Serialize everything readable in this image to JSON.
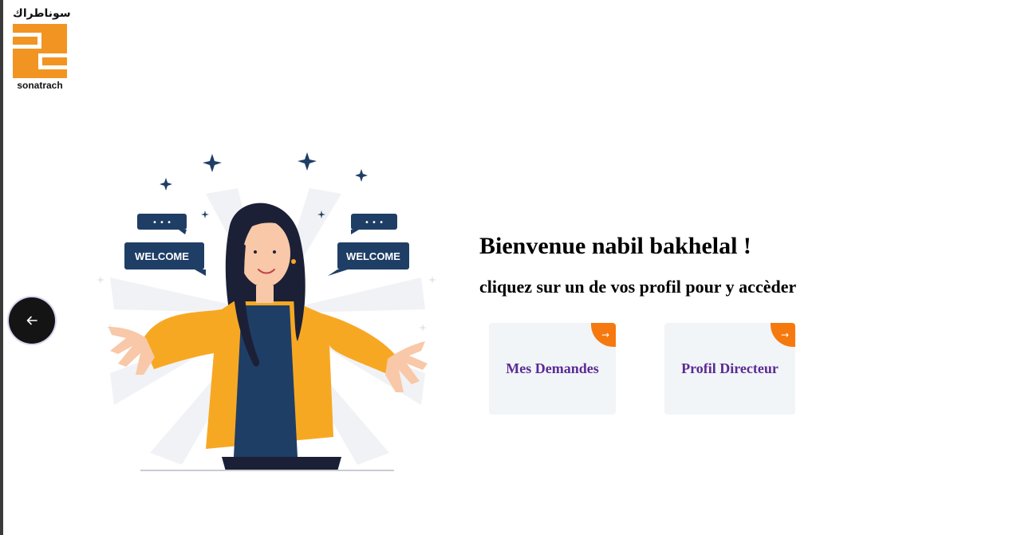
{
  "brand": {
    "arabic_name": "سوناطراك",
    "latin_name": "sonatrach",
    "color": "#f29422"
  },
  "back_button": {
    "icon": "arrow-left-icon"
  },
  "illustration": {
    "bubble_left_text": "WELCOME",
    "bubble_right_text": "WELCOME",
    "ellipsis": "• • •"
  },
  "main": {
    "greeting": "Bienvenue nabil bakhelal !",
    "instruction": "cliquez sur un de vos profil pour y accèder"
  },
  "profiles": [
    {
      "label": "Mes Demandes",
      "icon": "arrow-right-icon",
      "arrow": "→"
    },
    {
      "label": "Profil Directeur",
      "icon": "arrow-right-icon",
      "arrow": "→"
    }
  ],
  "colors": {
    "accent_orange": "#f6790f",
    "label_purple": "#5b2a93",
    "card_bg": "#f1f5f8",
    "bubble_navy": "#1f3e66"
  }
}
